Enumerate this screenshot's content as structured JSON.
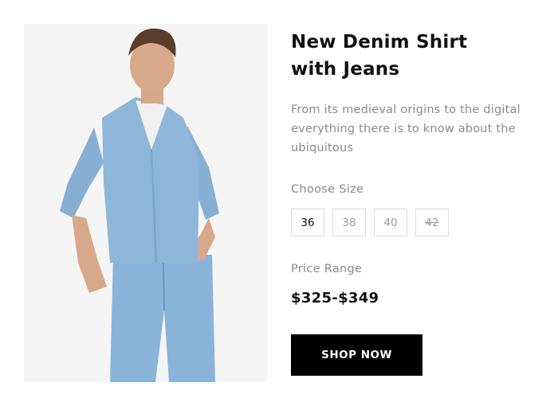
{
  "product": {
    "title": "New Denim Shirt with Jeans",
    "description": "From its medieval origins to the digital everything there is to know about the ubiquitous",
    "image_alt": "model-photo"
  },
  "size": {
    "label": "Choose Size",
    "options": [
      {
        "value": "36",
        "state": "selected"
      },
      {
        "value": "38",
        "state": "available"
      },
      {
        "value": "40",
        "state": "available"
      },
      {
        "value": "42",
        "state": "unavailable"
      }
    ]
  },
  "price": {
    "label": "Price Range",
    "value": "$325-$349"
  },
  "cta": {
    "label": "SHOP NOW"
  },
  "colors": {
    "button_bg": "#000000",
    "muted_text": "#8a8a8a",
    "photo_bg": "#f5f5f6",
    "shirt": "#8eb6d8",
    "jeans": "#8ab3d9"
  }
}
